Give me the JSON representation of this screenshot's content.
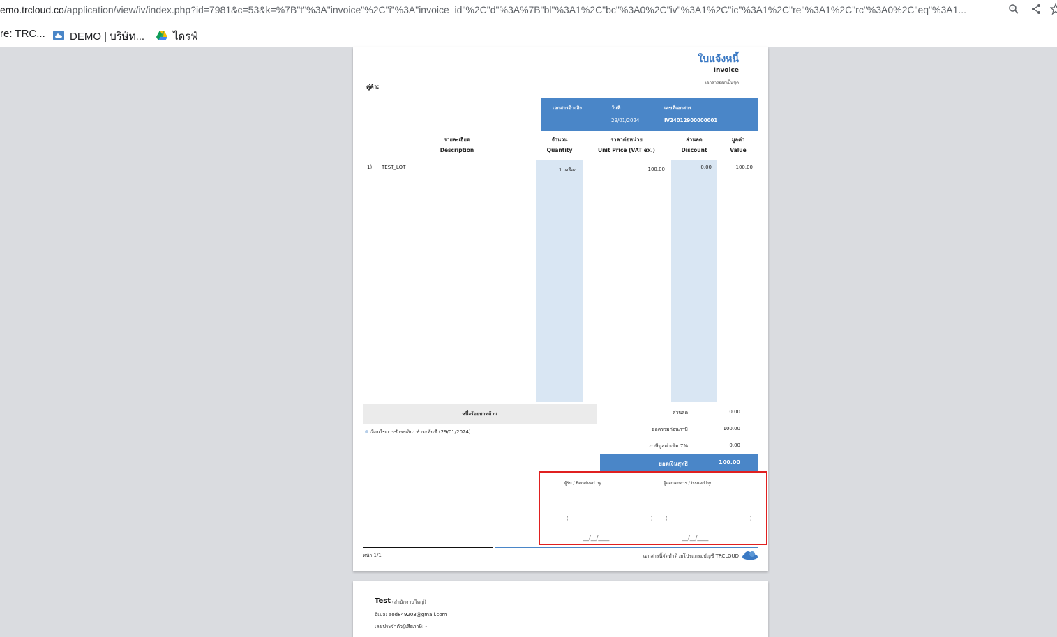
{
  "browser": {
    "url_domain": "emo.trcloud.co",
    "url_path": "/application/view/iv/index.php?id=7981&c=53&k=%7B\"t\"%3A\"invoice\"%2C\"i\"%3A\"invoice_id\"%2C\"d\"%3A%7B\"bl\"%3A1%2C\"bc\"%3A0%2C\"iv\"%3A1%2C\"ic\"%3A1%2C\"re\"%3A1%2C\"rc\"%3A0%2C\"eq\"%3A1...",
    "icons": [
      "zoom-icon",
      "share-icon",
      "star-icon"
    ],
    "bookmarks": [
      {
        "label": "re: TRC..."
      },
      {
        "label": "DEMO | บริษัท..."
      },
      {
        "label": "ไดรฟ์"
      }
    ]
  },
  "invoice": {
    "title_th": "ใบแจ้งหนี้",
    "title_en": "Invoice",
    "subtitle": "เอกสารออกเป็นชุด",
    "customer_label": "คู่ค้า:",
    "ref": {
      "ref_label": "เอกสารอ้างอิง",
      "date_label": "วันที่",
      "docno_label": "เลขที่เอกสาร",
      "date": "29/01/2024",
      "docno": "IV24012900000001"
    },
    "columns": {
      "desc_th": "รายละเอียด",
      "desc_en": "Description",
      "qty_th": "จำนวน",
      "qty_en": "Quantity",
      "price_th": "ราคาต่อหน่วย",
      "price_en": "Unit Price (VAT ex.)",
      "disc_th": "ส่วนลด",
      "disc_en": "Discount",
      "value_th": "มูลค่า",
      "value_en": "Value"
    },
    "items": [
      {
        "no": "1)",
        "description": "TEST_LOT",
        "quantity": "1 เครื่อง",
        "unit_price": "100.00",
        "discount": "0.00",
        "value": "100.00"
      }
    ],
    "amount_in_words": "หนึ่งร้อยบาทถ้วน",
    "payment_terms": "เงื่อนไขการชำระเงิน: ชำระทันที (29/01/2024)",
    "summary": {
      "discount_label": "ส่วนลด",
      "discount": "0.00",
      "subtotal_label": "ยอดรวมก่อนภาษี",
      "subtotal": "100.00",
      "vat_label": "ภาษีมูลค่าเพิ่ม 7%",
      "vat": "0.00",
      "total_label": "ยอดเงินสุทธิ",
      "total": "100.00"
    },
    "signatures": {
      "received_by": "ผู้รับ / Received by",
      "issued_by": "ผู้ออกเอกสาร / Issued by",
      "paren_open": "(",
      "paren_close": ")",
      "date_placeholder": "__/__/____"
    },
    "footer": {
      "page": "หน้า 1/1",
      "generated_by": "เอกสารนี้จัดทำด้วยโปรแกรมบัญชี TRCLOUD"
    }
  },
  "page2": {
    "company": "Test",
    "branch": "(สำนักงานใหญ่)",
    "email": "อีเมล: aod849203@gmail.com",
    "tax_id": "เลขประจำตัวผู้เสียภาษี: -"
  },
  "colors": {
    "accent": "#4a86c8",
    "shade": "#d9e6f3",
    "highlight": "#e02020"
  }
}
